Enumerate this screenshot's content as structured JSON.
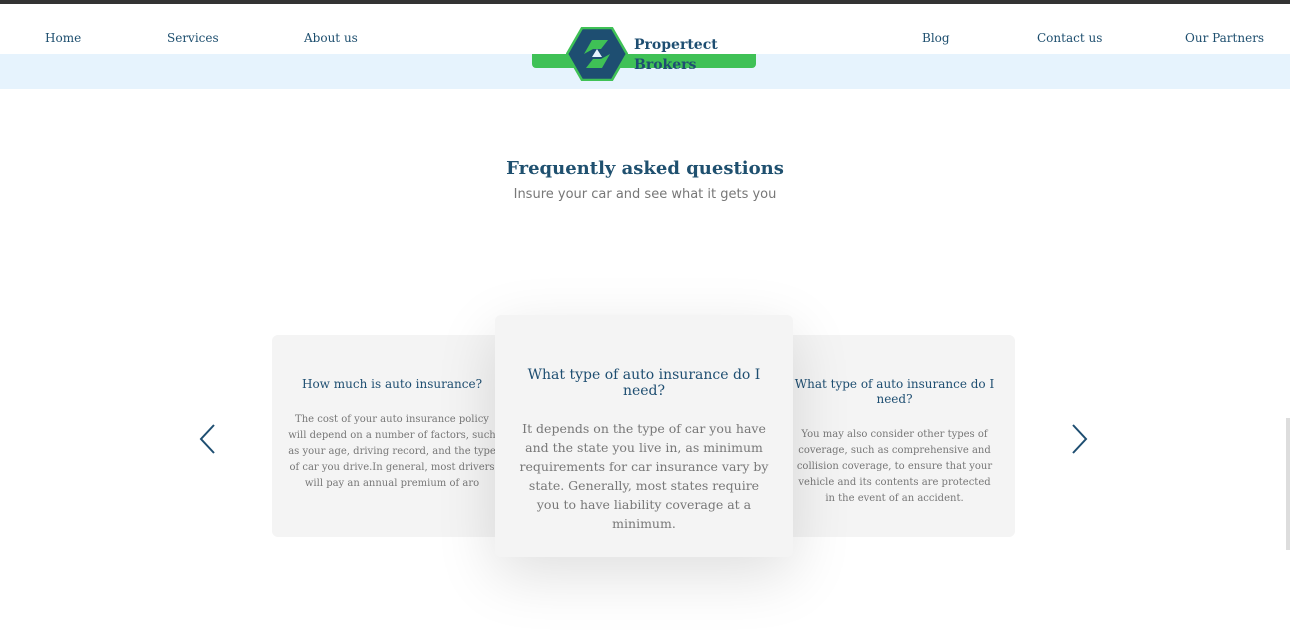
{
  "nav": {
    "left": [
      "Home",
      "Services",
      "About us"
    ],
    "right": [
      "Blog",
      "Contact us",
      "Our Partners"
    ]
  },
  "brand": {
    "line1": "Propertect",
    "line2": "Brokers",
    "colors": {
      "primary": "#1e4e71",
      "accent": "#3fc156"
    }
  },
  "faq": {
    "title": "Frequently asked questions",
    "subtitle": "Insure your car and see what it gets you",
    "cards": [
      {
        "question": "How much is auto insurance?",
        "answer": "The cost of your auto insurance policy will depend on a number of factors, such as your age, driving record, and the type of car you drive.In general, most drivers will pay an annual premium of aro"
      },
      {
        "question": "What type of auto insurance do I need?",
        "answer": "It depends on the type of car you have and the state you live in, as minimum requirements for car insurance vary by state. Generally, most states require you to have liability coverage at a minimum."
      },
      {
        "question": "What type of auto insurance do I need?",
        "answer": "You may also consider other types of coverage, such as comprehensive and collision coverage, to ensure that your vehicle and its contents are protected in the event of an accident."
      }
    ]
  },
  "icons": {
    "prev": "chevron-left-icon",
    "next": "chevron-right-icon"
  }
}
